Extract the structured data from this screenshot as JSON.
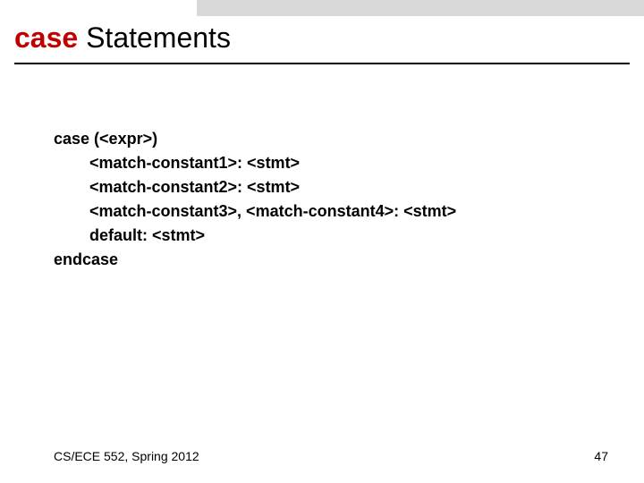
{
  "title": {
    "keyword": "case",
    "rest": " Statements"
  },
  "code": {
    "l1a": "case",
    "l1b": " (<expr>)",
    "l2": "<match-constant1>: <stmt>",
    "l3": "<match-constant2>: <stmt>",
    "l4": "<match-constant3>, <match-constant4>: <stmt>",
    "l5": "default: <stmt>",
    "l6": "endcase"
  },
  "footer": {
    "left": "CS/ECE 552, Spring 2012",
    "right": "47"
  }
}
